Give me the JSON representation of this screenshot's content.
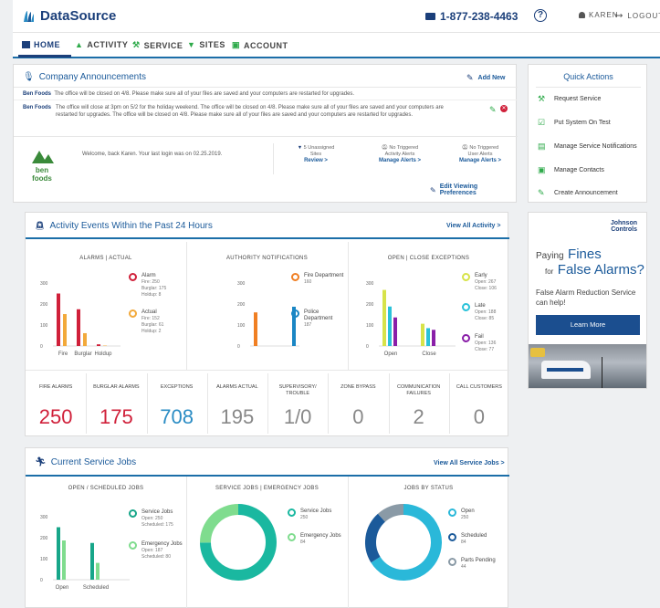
{
  "header": {
    "brand": "DataSource",
    "phone": "1-877-238-4463",
    "help_icon": "?",
    "user": "KAREN",
    "logout": "LOGOUT"
  },
  "nav": {
    "home": "HOME",
    "activity": "ACTIVITY",
    "service": "SERVICE",
    "sites": "SITES",
    "account": "ACCOUNT"
  },
  "announcements": {
    "title": "Company Announcements",
    "add_new": "Add New",
    "items": [
      {
        "company": "Ben Foods",
        "text": "The office will be closed on 4/8.  Please make sure all of your files are saved and your computers are restarted for upgrades."
      },
      {
        "company": "Ben Foods",
        "text": "The office will close at 3pm on 5/2 for the holiday weekend. The office will be closed on 4/8.  Please make sure all of your files are saved and your computers are restarted for upgrades.  The office will be closed on 4/8.  Please make sure all of your files are saved and your computers are restarted for upgrades."
      }
    ]
  },
  "welcome": {
    "logo_text": "ben foods",
    "message": "Welcome, back Karen. Your last login was on 02.25.2019.",
    "stat1_line1": "5 Unassigned",
    "stat1_line2": "Sites",
    "stat1_link": "Review >",
    "stat2_line1": "No Triggered",
    "stat2_line2": "Activity Alerts",
    "stat2_link": "Manage Alerts >",
    "stat3_line1": "No Triggered",
    "stat3_line2": "User Alerts",
    "stat3_link": "Manage Alerts >",
    "edit_prefs": "Edit Viewing Preferences"
  },
  "quick_actions": {
    "title": "Quick Actions",
    "items": [
      "Request Service",
      "Put System On Test",
      "Manage Service Notifications",
      "Manage Contacts",
      "Create Announcement"
    ]
  },
  "ad": {
    "brand_line1": "Johnson",
    "brand_line2": "Controls",
    "paying": "Paying",
    "fines": "Fines",
    "for": "for",
    "false_alarms": "False Alarms?",
    "sub": "False Alarm Reduction Service can help!",
    "button": "Learn More"
  },
  "activity": {
    "title": "Activity Events Within the Past 24 Hours",
    "view_all": "View All Activity >",
    "panel1_title": "ALARMS | ACTUAL",
    "panel2_title": "AUTHORITY NOTIFICATIONS",
    "panel3_title": "OPEN | CLOSE EXCEPTIONS",
    "legend": {
      "alarm": "Alarm",
      "alarm_fire": "Fire: 250",
      "alarm_burglar": "Burglar: 175",
      "alarm_holdup": "Holdup: 8",
      "actual": "Actual",
      "actual_fire": "Fire: 152",
      "actual_burglar": "Burglar: 61",
      "actual_holdup": "Holdup: 2",
      "fire_dept": "Fire Department",
      "fire_dept_val": "160",
      "police_dept": "Police Department",
      "police_dept_val": "187",
      "early": "Early",
      "early_open": "Open: 267",
      "early_close": "Close: 106",
      "late": "Late",
      "late_open": "Open: 188",
      "late_close": "Close: 85",
      "fail": "Fail",
      "fail_open": "Open: 136",
      "fail_close": "Close: 77"
    },
    "stats": [
      {
        "label": "FIRE ALARMS",
        "value": "250",
        "color": "#d0203a"
      },
      {
        "label": "BURGLAR ALARMS",
        "value": "175",
        "color": "#d0203a"
      },
      {
        "label": "EXCEPTIONS",
        "value": "708",
        "color": "#2a8cc4"
      },
      {
        "label": "ALARMS ACTUAL",
        "value": "195",
        "color": "#888888"
      },
      {
        "label": "SUPERVISORY/ TROUBLE",
        "value": "1/0",
        "color": "#888888"
      },
      {
        "label": "ZONE BYPASS",
        "value": "0",
        "color": "#888888"
      },
      {
        "label": "COMMUNICATION FAILURES",
        "value": "2",
        "color": "#888888"
      },
      {
        "label": "CALL CUSTOMERS",
        "value": "0",
        "color": "#888888"
      }
    ]
  },
  "service": {
    "title": "Current Service Jobs",
    "view_all": "View All Service Jobs >",
    "panel1_title": "OPEN / SCHEDULED JOBS",
    "panel2_title": "SERVICE JOBS | EMERGENCY JOBS",
    "panel3_title": "JOBS BY STATUS",
    "legend": {
      "service_jobs": "Service Jobs",
      "service_open": "Open: 250",
      "service_sched": "Scheduled: 175",
      "emergency": "Emergency Jobs",
      "emergency_open": "Open: 187",
      "emergency_sched": "Scheduled: 80",
      "d_service": "Service Jobs",
      "d_service_val": "250",
      "d_emergency": "Emergency Jobs",
      "d_emergency_val": "84",
      "s_open": "Open",
      "s_open_val": "250",
      "s_sched": "Scheduled",
      "s_sched_val": "84",
      "s_parts": "Parts Pending",
      "s_parts_val": "44"
    }
  },
  "chart_data": [
    {
      "type": "bar",
      "title": "ALARMS | ACTUAL",
      "categories": [
        "Fire",
        "Burglar",
        "Holdup"
      ],
      "ylim": [
        0,
        300
      ],
      "yticks": [
        "0",
        "100",
        "200",
        "300"
      ],
      "series": [
        {
          "name": "Alarm",
          "values": [
            250,
            175,
            8
          ],
          "color": "#d0203a"
        },
        {
          "name": "Actual",
          "values": [
            152,
            61,
            2
          ],
          "color": "#f2a93b"
        }
      ]
    },
    {
      "type": "bar",
      "title": "AUTHORITY NOTIFICATIONS",
      "categories": [
        ""
      ],
      "ylim": [
        0,
        300
      ],
      "yticks": [
        "0",
        "100",
        "200",
        "300"
      ],
      "series": [
        {
          "name": "Fire Department",
          "values": [
            160
          ],
          "color": "#f07f23"
        },
        {
          "name": "Police Department",
          "values": [
            187
          ],
          "color": "#1a86c4"
        }
      ]
    },
    {
      "type": "bar",
      "title": "OPEN | CLOSE EXCEPTIONS",
      "categories": [
        "Open",
        "Close"
      ],
      "ylim": [
        0,
        300
      ],
      "yticks": [
        "0",
        "100",
        "200",
        "300"
      ],
      "series": [
        {
          "name": "Early",
          "values": [
            267,
            106
          ],
          "color": "#d7e34a"
        },
        {
          "name": "Late",
          "values": [
            188,
            85
          ],
          "color": "#2ac2d9"
        },
        {
          "name": "Fail",
          "values": [
            136,
            77
          ],
          "color": "#8a1fa8"
        }
      ]
    },
    {
      "type": "bar",
      "title": "OPEN / SCHEDULED JOBS",
      "categories": [
        "Open",
        "Scheduled"
      ],
      "ylim": [
        0,
        300
      ],
      "yticks": [
        "0",
        "100",
        "200",
        "300"
      ],
      "series": [
        {
          "name": "Service Jobs",
          "values": [
            250,
            175
          ],
          "color": "#17a689"
        },
        {
          "name": "Emergency Jobs",
          "values": [
            187,
            80
          ],
          "color": "#7fdc8e"
        }
      ]
    },
    {
      "type": "pie",
      "title": "SERVICE JOBS | EMERGENCY JOBS",
      "categories": [
        "Service Jobs",
        "Emergency Jobs"
      ],
      "values": [
        250,
        84
      ],
      "colors": [
        "#1ab8a0",
        "#7fdc8e"
      ]
    },
    {
      "type": "pie",
      "title": "JOBS BY STATUS",
      "categories": [
        "Open",
        "Scheduled",
        "Parts Pending"
      ],
      "values": [
        250,
        84,
        44
      ],
      "colors": [
        "#2ab8d9",
        "#1b5a9a",
        "#8a9aa6"
      ]
    }
  ]
}
